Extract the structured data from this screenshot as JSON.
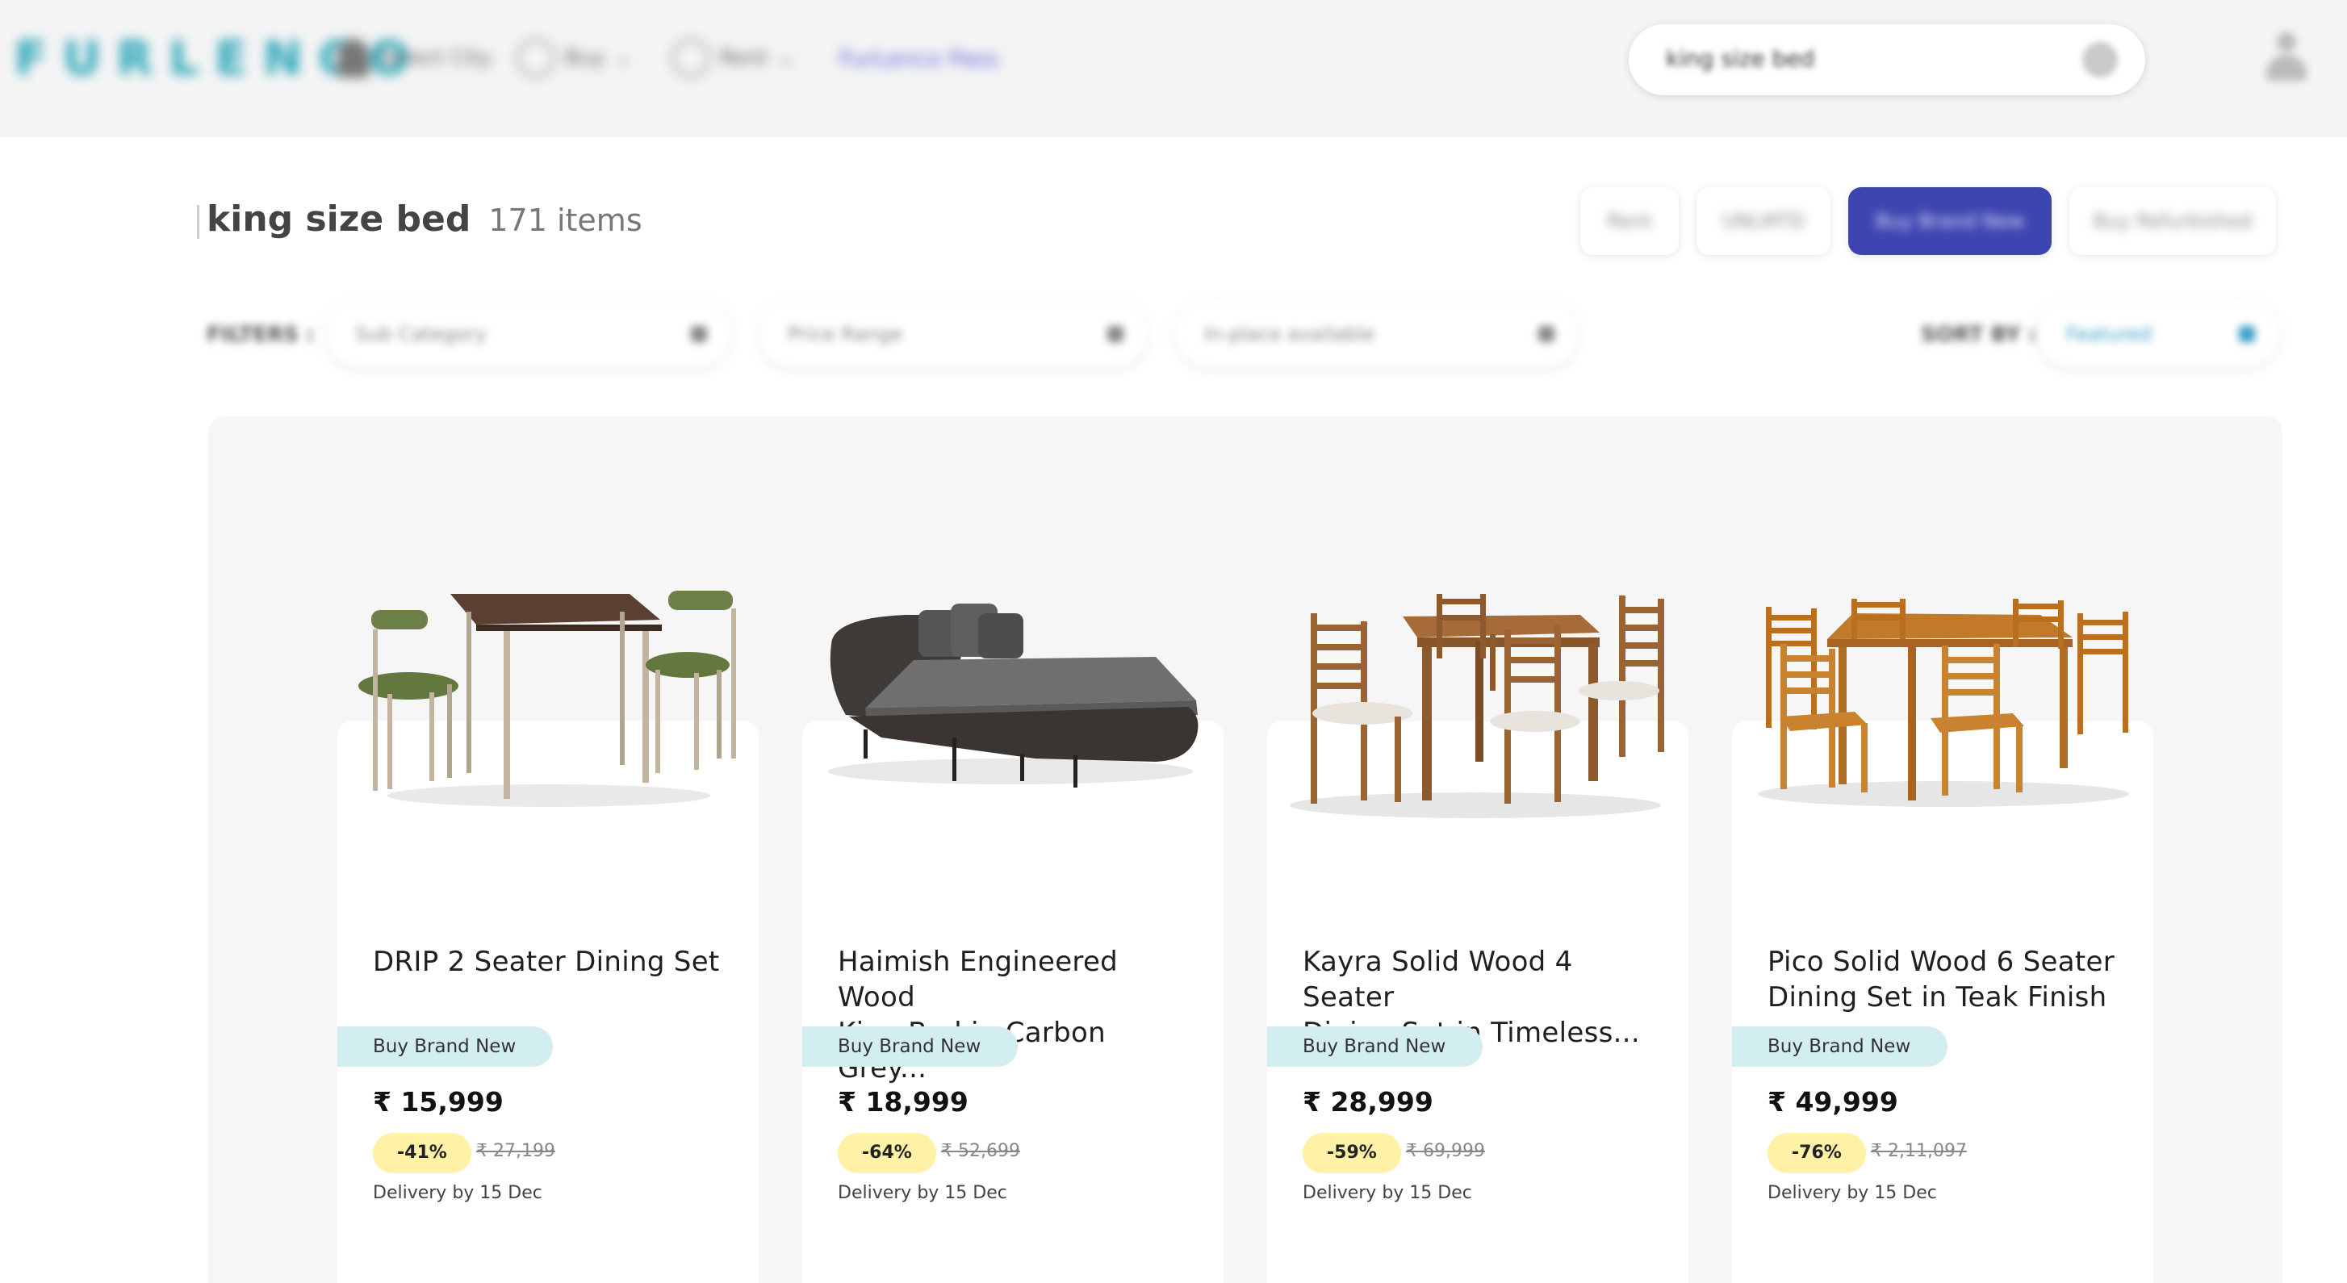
{
  "header": {
    "logo": "FURLENCO",
    "location_label": "Select City",
    "nav_buy": "Buy",
    "nav_rent": "Rent",
    "nav_link": "FurLenco Pass",
    "search_value": "king size bed"
  },
  "title": {
    "query": "king size bed",
    "count": "171 items"
  },
  "mode_tabs": [
    "Rent",
    "UNLMTD",
    "Buy Brand New",
    "Buy Refurbished"
  ],
  "filters": {
    "label": "FILTERS :",
    "category": "Sub Category",
    "price": "Price Range",
    "delivery": "In-place available",
    "sort_label": "SORT BY :",
    "sort_value": "Featured"
  },
  "products": [
    {
      "name": "DRIP 2 Seater Dining Set",
      "badge": "Buy Brand New",
      "price": "₹ 15,999",
      "discount": "-41%",
      "mrp": "₹ 27,199",
      "delivery": "Delivery by 15 Dec",
      "image": "dining-set-2-seater"
    },
    {
      "name": "Haimish Engineered Wood\nKing Bed in Carbon Grey...",
      "badge": "Buy Brand New",
      "price": "₹ 18,999",
      "discount": "-64%",
      "mrp": "₹ 52,699",
      "delivery": "Delivery by 15 Dec",
      "image": "king-bed"
    },
    {
      "name": "Kayra Solid Wood 4 Seater\nDining Set in Timeless...",
      "badge": "Buy Brand New",
      "price": "₹ 28,999",
      "discount": "-59%",
      "mrp": "₹ 69,999",
      "delivery": "Delivery by 15 Dec",
      "image": "dining-set-4-seater"
    },
    {
      "name": "Pico Solid Wood 6 Seater\nDining Set in Teak Finish",
      "badge": "Buy Brand New",
      "price": "₹ 49,999",
      "discount": "-76%",
      "mrp": "₹ 2,11,097",
      "delivery": "Delivery by 15 Dec",
      "image": "dining-set-6-seater"
    }
  ],
  "colors": {
    "brand_teal": "#2aa6b8",
    "active_tab": "#3d45b0",
    "badge_new": "#d3eef0",
    "discount_badge": "#fff2a6"
  }
}
